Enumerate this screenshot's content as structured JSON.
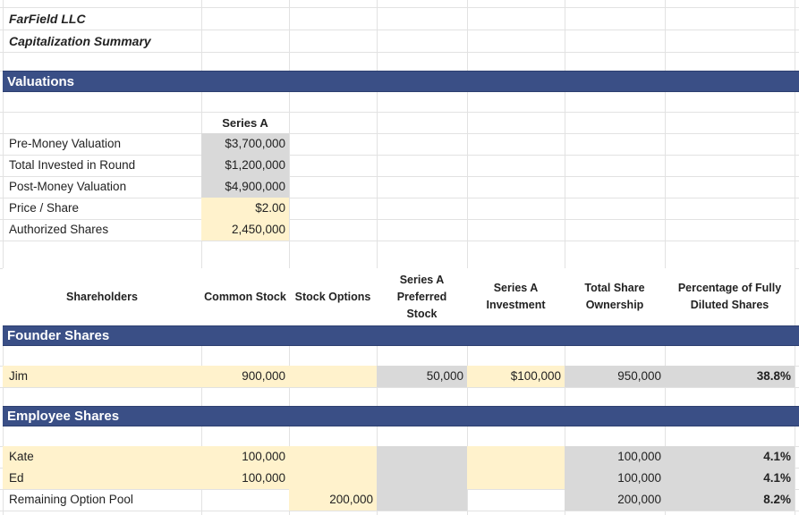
{
  "titles": {
    "company": "FarField LLC",
    "subtitle": "Capitalization Summary"
  },
  "sections": {
    "valuations": "Valuations",
    "founder": "Founder Shares",
    "employee": "Employee Shares"
  },
  "valuations": {
    "series_header": "Series A",
    "rows": [
      {
        "label": "Pre-Money Valuation",
        "value": "$3,700,000"
      },
      {
        "label": "Total Invested in Round",
        "value": "$1,200,000"
      },
      {
        "label": "Post-Money Valuation",
        "value": "$4,900,000"
      },
      {
        "label": "Price / Share",
        "value": "$2.00"
      },
      {
        "label": "Authorized Shares",
        "value": "2,450,000"
      }
    ]
  },
  "table_headers": {
    "shareholders": "Shareholders",
    "common_stock": "Common Stock",
    "stock_options": "Stock Options",
    "series_a_preferred": "Series A Preferred Stock",
    "series_a_investment": "Series A Investment",
    "total_ownership": "Total Share Ownership",
    "pct_fully_diluted": "Percentage of Fully Diluted Shares"
  },
  "founders": [
    {
      "name": "Jim",
      "common": "900,000",
      "options": "",
      "preferred": "50,000",
      "investment": "$100,000",
      "total": "950,000",
      "pct": "38.8%"
    }
  ],
  "employees": [
    {
      "name": "Kate",
      "common": "100,000",
      "options": "",
      "preferred": "",
      "investment": "",
      "total": "100,000",
      "pct": "4.1%"
    },
    {
      "name": "Ed",
      "common": "100,000",
      "options": "",
      "preferred": "",
      "investment": "",
      "total": "100,000",
      "pct": "4.1%"
    },
    {
      "name": "Remaining Option Pool",
      "common": "",
      "options": "200,000",
      "preferred": "",
      "investment": "",
      "total": "200,000",
      "pct": "8.2%"
    }
  ]
}
